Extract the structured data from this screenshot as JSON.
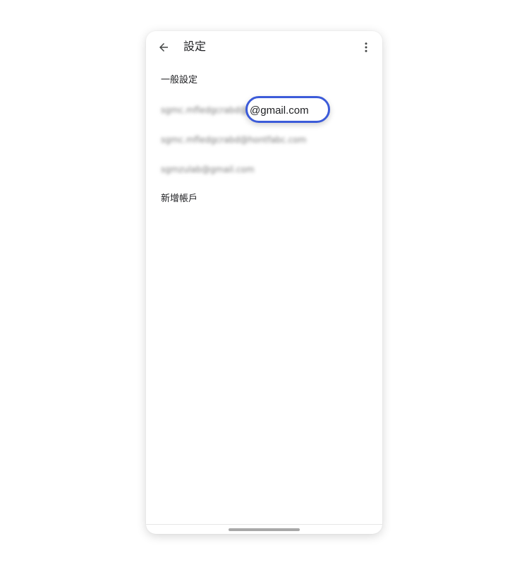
{
  "header": {
    "title": "設定",
    "back_icon": "arrow-back-icon",
    "more_icon": "more-vert-icon"
  },
  "settings": {
    "general_label": "一般設定",
    "accounts": [
      "sgmc.mfledgcrabd@gmail.com",
      "sgmc.mfledgcrabd@hontfabc.com",
      "sgmzulab@gmail.com"
    ],
    "highlight_label": "@gmail.com",
    "add_account_label": "新增帳戶"
  },
  "colors": {
    "highlight_border": "#3c5bd9",
    "text": "#202124",
    "home_indicator": "#a8a8a8"
  }
}
